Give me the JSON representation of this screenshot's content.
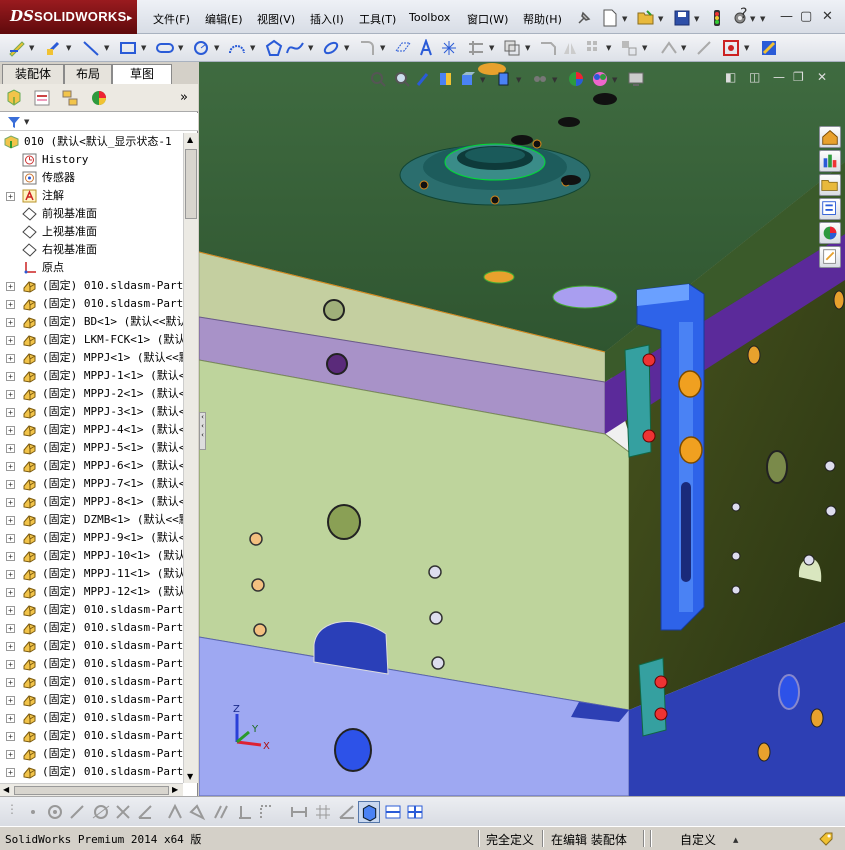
{
  "app": {
    "logo_ds": "DS",
    "logo_text": "SOLIDWORKS"
  },
  "menu": [
    "文件(F)",
    "编辑(E)",
    "视图(V)",
    "插入(I)",
    "工具(T)",
    "Toolbox",
    "窗口(W)",
    "帮助(H)"
  ],
  "tabs": [
    "装配体",
    "布局",
    "草图"
  ],
  "active_tab": "草图",
  "tree": {
    "root": "010  (默认<默认_显示状态-1",
    "items": [
      {
        "text": "History",
        "icon": "history-icon",
        "expand": false
      },
      {
        "text": "传感器",
        "icon": "sensor-icon",
        "expand": false
      },
      {
        "text": "注解",
        "icon": "annotation-icon",
        "expand": true
      },
      {
        "text": "前视基准面",
        "icon": "plane-icon",
        "expand": false
      },
      {
        "text": "上视基准面",
        "icon": "plane-icon",
        "expand": false
      },
      {
        "text": "右视基准面",
        "icon": "plane-icon",
        "expand": false
      },
      {
        "text": "原点",
        "icon": "origin-icon",
        "expand": false
      },
      {
        "text": "(固定) 010.sldasm-Part-",
        "icon": "part-icon",
        "expand": true
      },
      {
        "text": "(固定) 010.sldasm-Part-",
        "icon": "part-icon",
        "expand": true
      },
      {
        "text": "(固定) BD<1> (默认<<默认",
        "icon": "part-icon",
        "expand": true
      },
      {
        "text": "(固定) LKM-FCK<1> (默认",
        "icon": "part-icon",
        "expand": true
      },
      {
        "text": "(固定) MPPJ<1> (默认<<默",
        "icon": "part-icon",
        "expand": true
      },
      {
        "text": "(固定) MPPJ-1<1> (默认<",
        "icon": "part-icon",
        "expand": true
      },
      {
        "text": "(固定) MPPJ-2<1> (默认<",
        "icon": "part-icon",
        "expand": true
      },
      {
        "text": "(固定) MPPJ-3<1> (默认<",
        "icon": "part-icon",
        "expand": true
      },
      {
        "text": "(固定) MPPJ-4<1> (默认<",
        "icon": "part-icon",
        "expand": true
      },
      {
        "text": "(固定) MPPJ-5<1> (默认<",
        "icon": "part-icon",
        "expand": true
      },
      {
        "text": "(固定) MPPJ-6<1> (默认<",
        "icon": "part-icon",
        "expand": true
      },
      {
        "text": "(固定) MPPJ-7<1> (默认<",
        "icon": "part-icon",
        "expand": true
      },
      {
        "text": "(固定) MPPJ-8<1> (默认<",
        "icon": "part-icon",
        "expand": true
      },
      {
        "text": "(固定) DZMB<1> (默认<<默",
        "icon": "part-icon",
        "expand": true
      },
      {
        "text": "(固定) MPPJ-9<1> (默认<",
        "icon": "part-icon",
        "expand": true
      },
      {
        "text": "(固定) MPPJ-10<1> (默认",
        "icon": "part-icon",
        "expand": true
      },
      {
        "text": "(固定) MPPJ-11<1> (默认",
        "icon": "part-icon",
        "expand": true
      },
      {
        "text": "(固定) MPPJ-12<1> (默认",
        "icon": "part-icon",
        "expand": true
      },
      {
        "text": "(固定) 010.sldasm-Part-",
        "icon": "part-icon",
        "expand": true
      },
      {
        "text": "(固定) 010.sldasm-Part-",
        "icon": "part-icon",
        "expand": true
      },
      {
        "text": "(固定) 010.sldasm-Part-",
        "icon": "part-icon",
        "expand": true
      },
      {
        "text": "(固定) 010.sldasm-Part-",
        "icon": "part-icon",
        "expand": true
      },
      {
        "text": "(固定) 010.sldasm-Part-",
        "icon": "part-icon",
        "expand": true
      },
      {
        "text": "(固定) 010.sldasm-Part-",
        "icon": "part-icon",
        "expand": true
      },
      {
        "text": "(固定) 010.sldasm-Part-",
        "icon": "part-icon",
        "expand": true
      },
      {
        "text": "(固定) 010.sldasm-Part-",
        "icon": "part-icon",
        "expand": true
      },
      {
        "text": "(固定) 010.sldasm-Part-",
        "icon": "part-icon",
        "expand": true
      },
      {
        "text": "(固定) 010.sldasm-Part-",
        "icon": "part-icon",
        "expand": true
      }
    ]
  },
  "triad": {
    "x": "X",
    "y": "Y",
    "z": "Z"
  },
  "status": {
    "version": "SolidWorks Premium 2014 x64 版",
    "defined": "完全定义",
    "editing": "在编辑 装配体",
    "units": "自定义"
  },
  "colors": {
    "top_plate": "#39613a",
    "plate_tan": "#c7d3a4",
    "plate_purple": "#a78fc7",
    "plate_green": "#bdd39a",
    "side_dark": "#3d4a1f",
    "bottom_blue": "#9ea9f3",
    "accent_blue": "#2e63e9",
    "orange": "#e8a12d"
  }
}
